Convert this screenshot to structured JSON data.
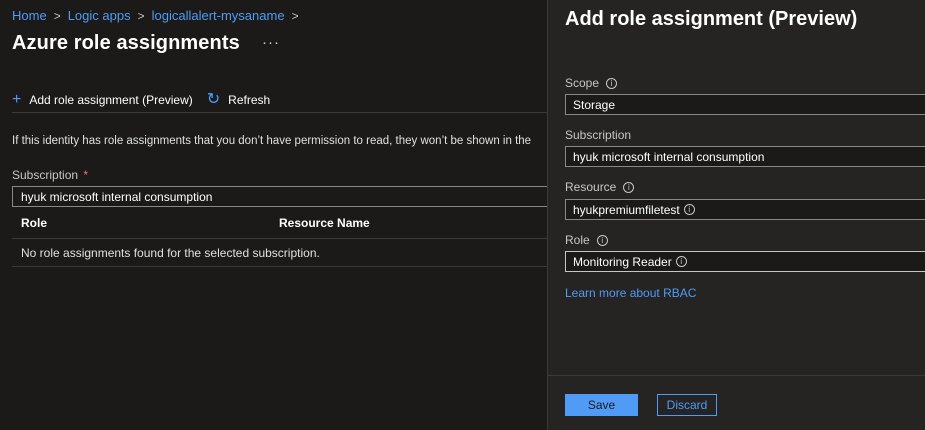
{
  "breadcrumb": {
    "items": [
      "Home",
      "Logic apps",
      "logicallalert-mysaname"
    ],
    "separator": ">"
  },
  "page": {
    "title": "Azure role assignments",
    "more_label": "···"
  },
  "toolbar": {
    "add_label": "Add role assignment (Preview)",
    "refresh_label": "Refresh"
  },
  "info_text": "If this identity has role assignments that you don’t have permission to read, they won’t be shown in the",
  "subscription": {
    "label": "Subscription",
    "required_mark": "*",
    "value": "hyuk microsoft internal consumption"
  },
  "grid": {
    "columns": [
      "Role",
      "Resource Name"
    ],
    "empty_message": "No role assignments found for the selected subscription."
  },
  "blade": {
    "title": "Add role assignment (Preview)",
    "scope": {
      "label": "Scope",
      "value": "Storage"
    },
    "subscription": {
      "label": "Subscription",
      "value": "hyuk microsoft internal consumption"
    },
    "resource": {
      "label": "Resource",
      "value": "hyukpremiumfiletest"
    },
    "role": {
      "label": "Role",
      "value": "Monitoring Reader"
    },
    "rbac_link": "Learn more about RBAC",
    "save_label": "Save",
    "discard_label": "Discard"
  },
  "icons": {
    "info": "ⓘ",
    "add": "+",
    "refresh": "↻"
  },
  "colors": {
    "accent": "#4f9bf5",
    "background": "#1b1a19",
    "panel": "#252423",
    "required": "#f1707b"
  }
}
